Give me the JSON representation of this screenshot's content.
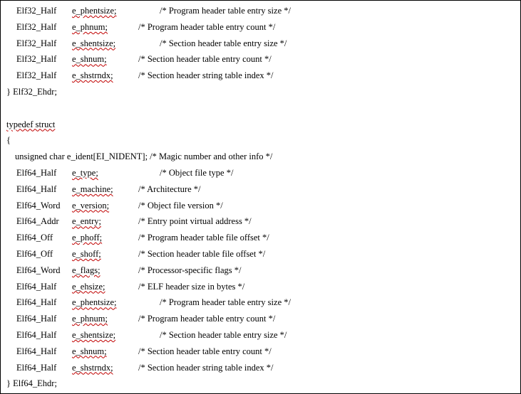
{
  "lines": [
    {
      "type": "Elf32_Half",
      "field": "e_phentsize;",
      "comment": "/* Program header table entry size */",
      "ctab": 2,
      "sq": true
    },
    {
      "type": "Elf32_Half",
      "field": "e_phnum;",
      "comment": "/* Program header table entry count */",
      "ctab": 1,
      "sq": true
    },
    {
      "type": "Elf32_Half",
      "field": "e_shentsize;",
      "comment": "/* Section header table entry size */",
      "ctab": 2,
      "sq": true
    },
    {
      "type": "Elf32_Half",
      "field": "e_shnum;",
      "comment": "/* Section header table entry count */",
      "ctab": 1,
      "sq": true
    },
    {
      "type": "Elf32_Half",
      "field": "e_shstrndx;",
      "comment": "/* Section header string table index */",
      "ctab": 1,
      "sq": true
    },
    {
      "raw": "} Elf32_Ehdr;"
    },
    {
      "raw": ""
    },
    {
      "raw": "typedef struct",
      "sq": true
    },
    {
      "raw": "{"
    },
    {
      "raw2": "unsigned char e_ident[EI_NIDENT]; /* Magic number and other info */"
    },
    {
      "type": "Elf64_Half",
      "field": "e_type;",
      "comment": "/* Object file type */",
      "ctab": 2,
      "sq": true
    },
    {
      "type": "Elf64_Half",
      "field": "e_machine;",
      "comment": "/* Architecture */",
      "ctab": 1,
      "sq": true
    },
    {
      "type": "Elf64_Word",
      "field": "e_version;",
      "comment": "/* Object file version */",
      "ctab": 1,
      "sq": true
    },
    {
      "type": "Elf64_Addr",
      "field": "e_entry;",
      "comment": "/* Entry point virtual address */",
      "ctab": 1,
      "sq": true
    },
    {
      "type": "Elf64_Off",
      "field": "e_phoff;",
      "comment": "/* Program header table file offset */",
      "ctab": 1,
      "sq": true
    },
    {
      "type": "Elf64_Off",
      "field": "e_shoff;",
      "comment": "/* Section header table file offset */",
      "ctab": 1,
      "sq": true
    },
    {
      "type": "Elf64_Word",
      "field": "e_flags;",
      "comment": "/* Processor-specific flags */",
      "ctab": 1,
      "sq": true
    },
    {
      "type": "Elf64_Half",
      "field": "e_ehsize;",
      "comment": "/* ELF header size in bytes */",
      "ctab": 1,
      "sq": true
    },
    {
      "type": "Elf64_Half",
      "field": "e_phentsize;",
      "comment": "/* Program header table entry size */",
      "ctab": 2,
      "sq": true
    },
    {
      "type": "Elf64_Half",
      "field": "e_phnum;",
      "comment": "/* Program header table entry count */",
      "ctab": 1,
      "sq": true
    },
    {
      "type": "Elf64_Half",
      "field": "e_shentsize;",
      "comment": "/* Section header table entry size */",
      "ctab": 2,
      "sq": true
    },
    {
      "type": "Elf64_Half",
      "field": "e_shnum;",
      "comment": "/* Section header table entry count */",
      "ctab": 1,
      "sq": true
    },
    {
      "type": "Elf64_Half",
      "field": "e_shstrndx;",
      "comment": "/* Section header string table index */",
      "ctab": 1,
      "sq": true
    },
    {
      "raw": "} Elf64_Ehdr;"
    }
  ]
}
